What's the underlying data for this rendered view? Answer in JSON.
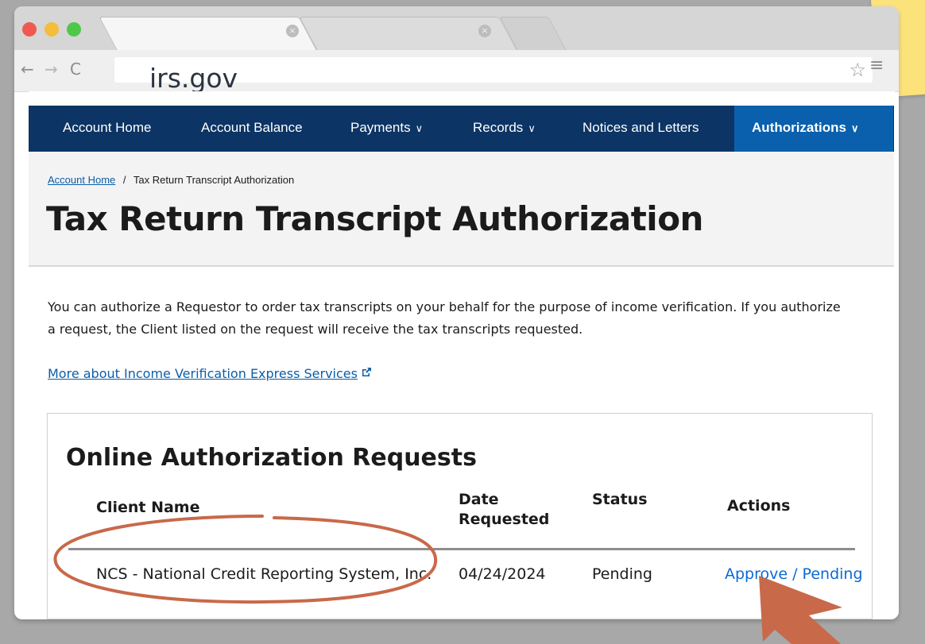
{
  "browser": {
    "url": "irs.gov",
    "tab_close_icon": "×",
    "back_icon": "←",
    "forward_icon": "→",
    "reload_icon": "C",
    "star_icon": "☆",
    "menu_icon": "≡"
  },
  "nav": {
    "items": [
      {
        "label": "Account Home"
      },
      {
        "label": "Account Balance"
      },
      {
        "label": "Payments"
      },
      {
        "label": "Records"
      },
      {
        "label": "Notices and Letters"
      },
      {
        "label": "Authorizations"
      }
    ],
    "chevron": "∨"
  },
  "breadcrumb": {
    "home": "Account Home",
    "separator": "/",
    "current": "Tax Return Transcript Authorization"
  },
  "page_title": "Tax Return Transcript Authorization",
  "intro": "You can authorize a Requestor to order tax transcripts on your behalf for the purpose of income verification. If you authorize a request, the Client listed on the request will receive the tax transcripts requested.",
  "more_link": "More about Income Verification Express Services",
  "card": {
    "title": "Online Authorization Requests",
    "headers": {
      "client": "Client Name",
      "date_line1": "Date",
      "date_line2": "Requested",
      "status": "Status",
      "actions": "Actions"
    },
    "rows": [
      {
        "client": "NCS - National Credit Reporting System, Inc.",
        "date": "04/24/2024",
        "status": "Pending",
        "action": "Approve / Pending"
      }
    ]
  },
  "colors": {
    "nav_bg": "#0c3464",
    "nav_active": "#0a60ad",
    "link": "#0b5ea8",
    "annotation": "#c8694a",
    "sticky_note": "#fbe27a"
  }
}
